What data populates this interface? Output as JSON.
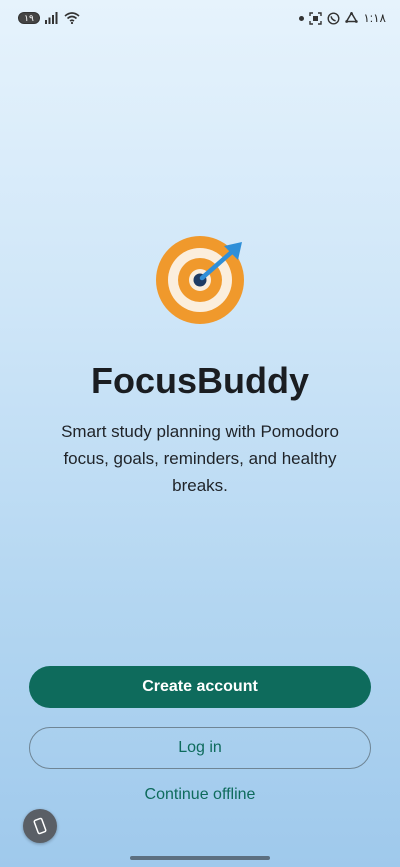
{
  "status_bar": {
    "battery": "١٩",
    "time": "١:١٨",
    "icons": [
      "signal-icon",
      "wifi-icon",
      "dot-icon",
      "screenshot-icon",
      "whatsapp-icon",
      "sync-icon"
    ]
  },
  "app": {
    "logo_icon": "target-arrow-icon",
    "title": "FocusBuddy",
    "tagline": "Smart study planning with Pomodoro focus, goals, reminders, and healthy breaks."
  },
  "actions": {
    "create_account": "Create account",
    "log_in": "Log in",
    "continue_offline": "Continue offline"
  },
  "floating": {
    "icon": "phone-rotate-icon"
  },
  "colors": {
    "primary": "#0e6b5c",
    "logo_orange": "#f0992c",
    "logo_cream": "#fbeedd",
    "arrow_blue": "#2f8fd8",
    "bullseye": "#1f3b63"
  }
}
